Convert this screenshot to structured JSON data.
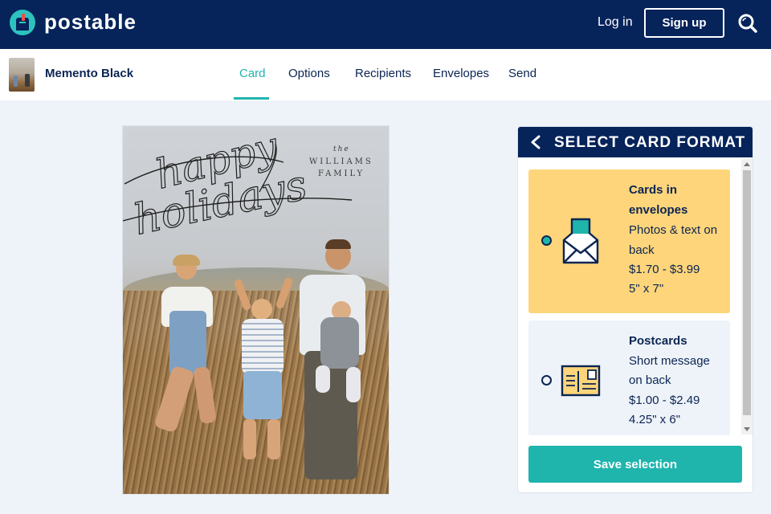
{
  "header": {
    "brand": "postable",
    "login_label": "Log in",
    "signup_label": "Sign up",
    "search_icon": "search-icon"
  },
  "subnav": {
    "product_name": "Memento Black",
    "tabs": [
      {
        "label": "Card",
        "active": true
      },
      {
        "label": "Options",
        "active": false
      },
      {
        "label": "Recipients",
        "active": false
      },
      {
        "label": "Envelopes",
        "active": false
      },
      {
        "label": "Send",
        "active": false
      }
    ]
  },
  "card_preview": {
    "greeting_line1": "happy",
    "greeting_line2": "holidays",
    "family_the": "the",
    "family_line1": "WILLIAMS",
    "family_line2": "FAMILY"
  },
  "format_panel": {
    "title": "SELECT CARD FORMAT",
    "options": [
      {
        "title_line1": "Cards in",
        "title_line2": "envelopes",
        "desc_line1": "Photos & text on",
        "desc_line2": "back",
        "price": "$1.70 - $3.99",
        "size": "5\" x 7\"",
        "icon": "envelope-icon",
        "selected": true
      },
      {
        "title_line1": "Postcards",
        "desc_line1": "Short message",
        "desc_line2": "on back",
        "price": "$1.00 - $2.49",
        "size": "4.25\" x 6\"",
        "icon": "postcard-icon",
        "selected": false
      }
    ],
    "save_label": "Save selection"
  },
  "colors": {
    "navy": "#06235a",
    "teal": "#1fb5ad",
    "selected_bg": "#fed57a",
    "page_bg": "#eef3f9"
  }
}
